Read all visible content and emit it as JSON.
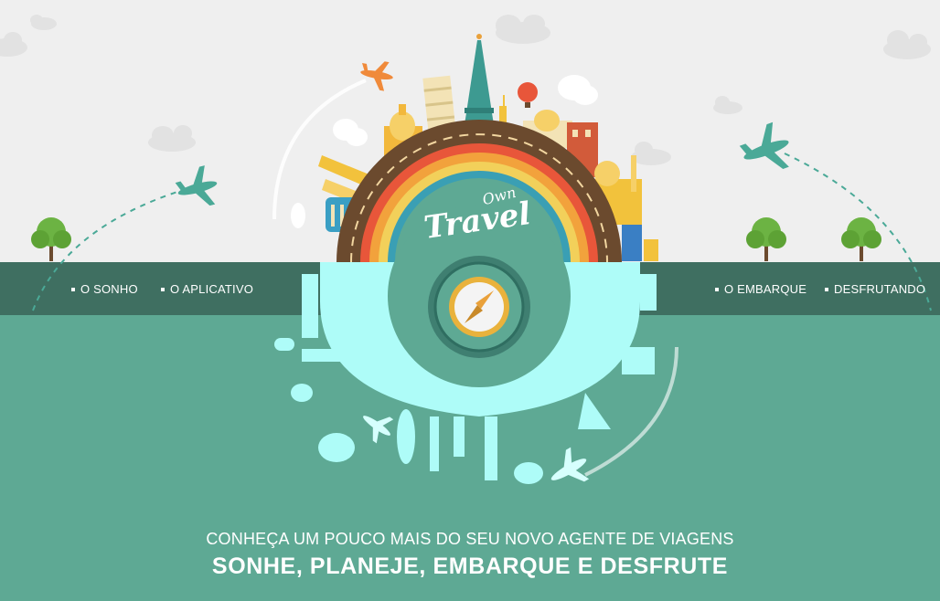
{
  "nav": {
    "left": [
      {
        "label": "O SONHO"
      },
      {
        "label": "O APLICATIVO"
      }
    ],
    "right": [
      {
        "label": "O EMBARQUE"
      },
      {
        "label": "DESFRUTANDO"
      }
    ]
  },
  "logo": {
    "line1": "Own",
    "line2": "Travel"
  },
  "hero": {
    "subtitle": "CONHEÇA UM POUCO MAIS DO SEU NOVO AGENTE DE VIAGENS",
    "headline": "SONHE, PLANEJE, EMBARQUE E DESFRUTE"
  },
  "colors": {
    "sky": "#efefef",
    "nav_band": "#3f6f61",
    "teal": "#5ea994",
    "cyan_reflection": "#aefcf8",
    "road": "#6b4a2e"
  }
}
